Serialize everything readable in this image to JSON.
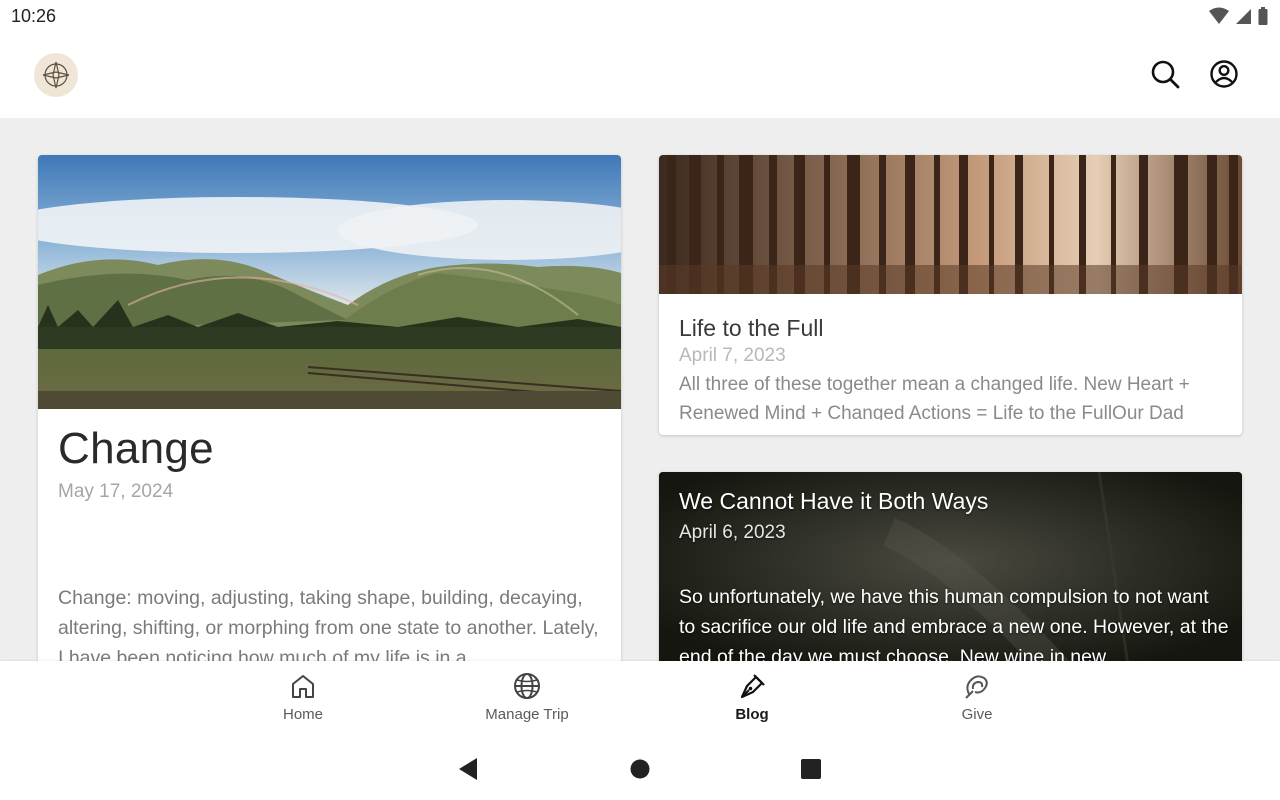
{
  "status_bar": {
    "time": "10:26"
  },
  "app_bar": {
    "logo_icon": "compass-logo-icon",
    "search_icon": "search-icon",
    "account_icon": "account-circle-icon"
  },
  "posts": [
    {
      "title": "Change",
      "date": "May 17, 2024",
      "excerpt": "Change: moving, adjusting, taking shape, building, decaying, altering, shifting, or morphing from one state to another. Lately, I have been noticing how much of my life is in a",
      "image": "mountain-rainbow-image"
    },
    {
      "title": "Life to the Full",
      "date": "April 7, 2023",
      "excerpt": "All three of these together mean a changed life. New Heart + Renewed Mind + Changed Actions = Life to the FullOur Dad",
      "image": "forest-image"
    },
    {
      "title": "We Cannot Have it Both Ways",
      "date": "April 6, 2023",
      "excerpt": "So unfortunately, we have this human compulsion to not want to sacrifice our old life and embrace a new one. However, at the end of the day we must choose. New wine in new",
      "image": "dark-road-image"
    }
  ],
  "bottom_nav": [
    {
      "label": "Home",
      "icon": "home-icon",
      "active": false
    },
    {
      "label": "Manage Trip",
      "icon": "globe-icon",
      "active": false
    },
    {
      "label": "Blog",
      "icon": "pen-nib-icon",
      "active": true
    },
    {
      "label": "Give",
      "icon": "give-icon",
      "active": false
    }
  ],
  "colors": {
    "background": "#eeeeee",
    "card": "#ffffff",
    "logo_bg": "#efe6d8",
    "dark_card": "#1d1f1a"
  }
}
